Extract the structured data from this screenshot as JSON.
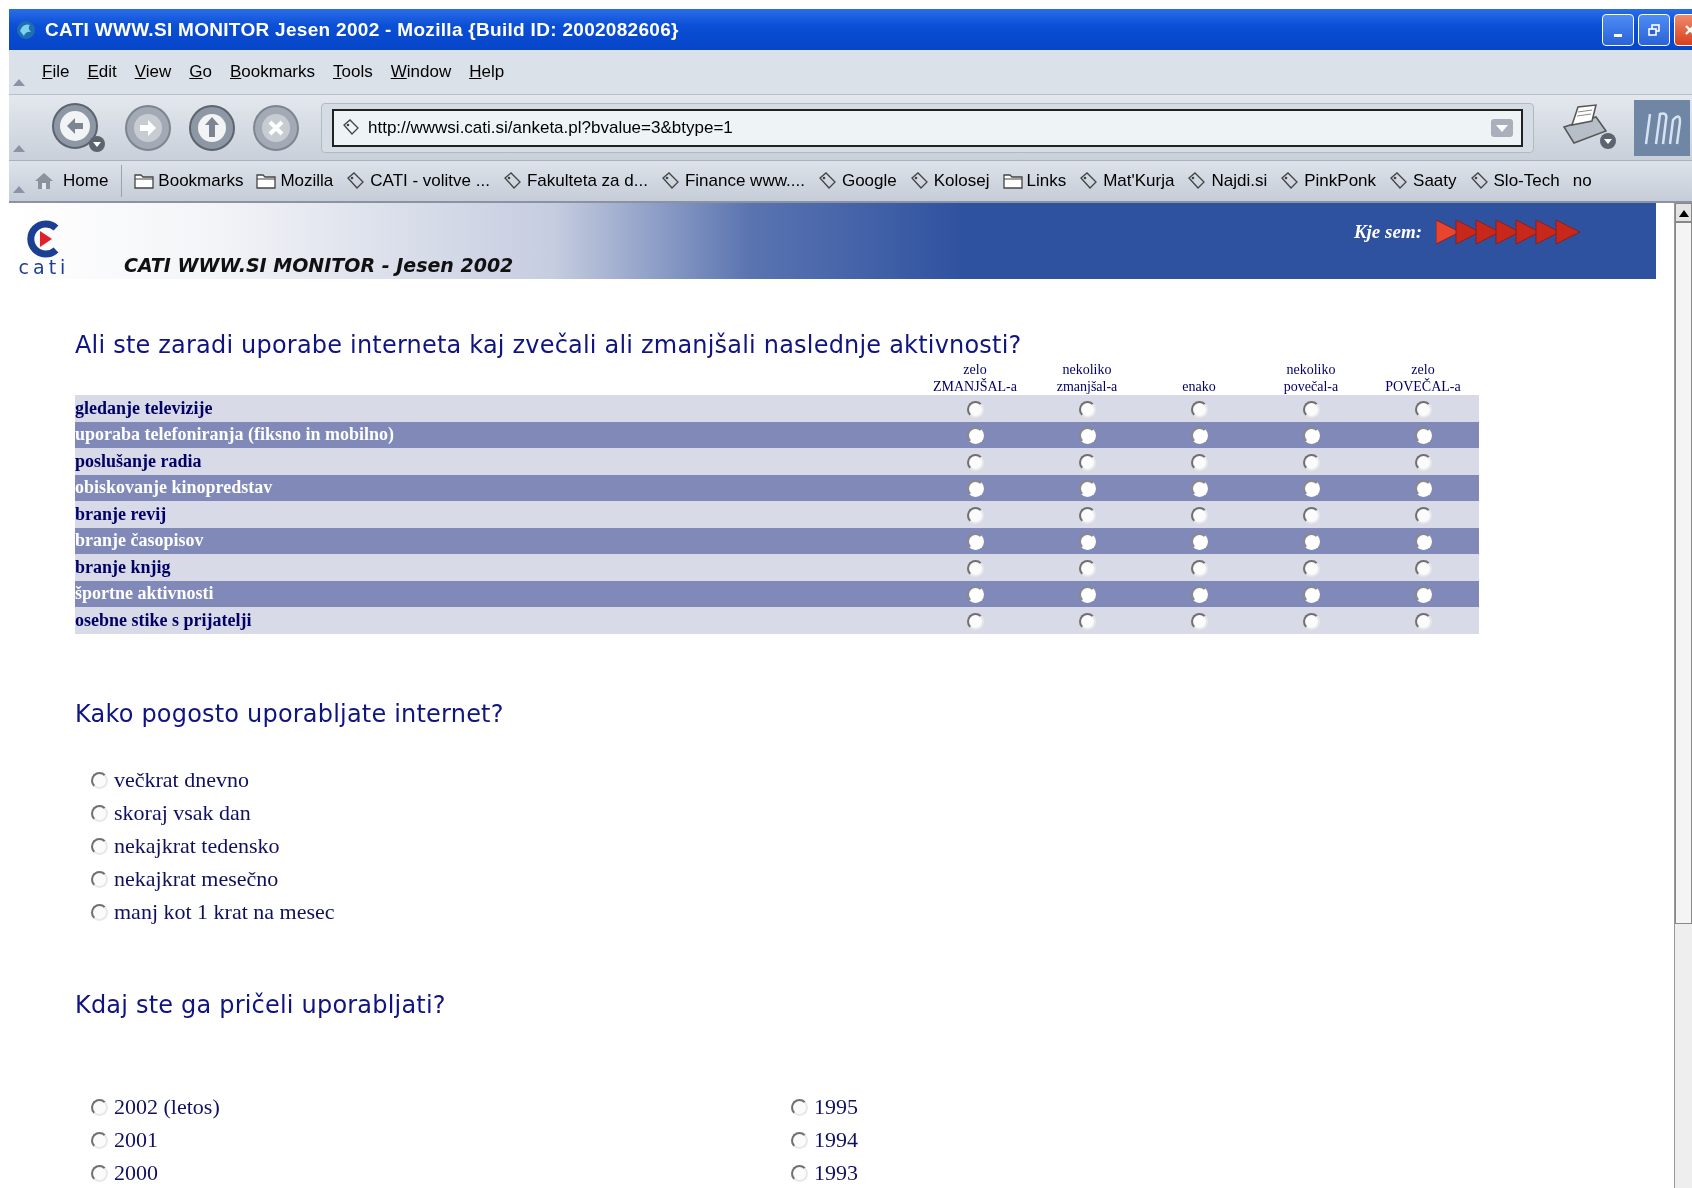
{
  "window": {
    "title": "CATI WWW.SI MONITOR Jesen 2002 - Mozilla {Build ID: 2002082606}"
  },
  "menu": [
    "File",
    "Edit",
    "View",
    "Go",
    "Bookmarks",
    "Tools",
    "Window",
    "Help"
  ],
  "address": {
    "value": "http://wwwsi.cati.si/anketa.pl?bvalue=3&btype=1"
  },
  "bookmarks": [
    {
      "label": "Home",
      "kind": "home"
    },
    {
      "label": "Bookmarks",
      "kind": "folder"
    },
    {
      "label": "Mozilla",
      "kind": "folder"
    },
    {
      "label": "CATI - volitve ...",
      "kind": "link"
    },
    {
      "label": "Fakulteta za d...",
      "kind": "link"
    },
    {
      "label": "Finance www....",
      "kind": "link"
    },
    {
      "label": "Google",
      "kind": "link"
    },
    {
      "label": "Kolosej",
      "kind": "link"
    },
    {
      "label": "Links",
      "kind": "folder"
    },
    {
      "label": "Mat'Kurja",
      "kind": "link"
    },
    {
      "label": "Najdi.si",
      "kind": "link"
    },
    {
      "label": "PinkPonk",
      "kind": "link"
    },
    {
      "label": "Saaty",
      "kind": "link"
    },
    {
      "label": "Slo-Tech",
      "kind": "link"
    },
    {
      "label": "no",
      "kind": "plain"
    }
  ],
  "banner": {
    "logo_text": "cati",
    "title": "CATI WWW.SI MONITOR - Jesen 2002",
    "location_label": "Kje sem:"
  },
  "questions": [
    {
      "kind": "matrix",
      "text": "Ali ste zaradi uporabe interneta kaj zvečali ali zmanjšali naslednje aktivnosti?",
      "columns": [
        "zelo\nZMANJŠAL-a",
        "nekoliko\nzmanjšal-a",
        "enako",
        "nekoliko\npovečal-a",
        "zelo\nPOVEČAL-a"
      ],
      "rows": [
        {
          "label": "gledanje televizije",
          "selected": [
            false,
            false,
            false,
            false,
            false
          ]
        },
        {
          "label": "uporaba telefoniranja (fiksno in mobilno)",
          "selected": [
            false,
            false,
            false,
            false,
            false
          ]
        },
        {
          "label": "poslušanje radia",
          "selected": [
            false,
            false,
            false,
            false,
            false
          ]
        },
        {
          "label": "obiskovanje kinopredstav",
          "selected": [
            false,
            false,
            false,
            false,
            false
          ]
        },
        {
          "label": "branje revij",
          "selected": [
            false,
            false,
            false,
            false,
            false
          ]
        },
        {
          "label": "branje časopisov",
          "selected": [
            false,
            false,
            false,
            false,
            false
          ]
        },
        {
          "label": "branje knjig",
          "selected": [
            false,
            false,
            false,
            false,
            false
          ]
        },
        {
          "label": "športne aktivnosti",
          "selected": [
            false,
            false,
            false,
            false,
            false
          ]
        },
        {
          "label": "osebne stike s prijatelji",
          "selected": [
            false,
            false,
            false,
            false,
            false
          ]
        }
      ]
    },
    {
      "kind": "single",
      "text": "Kako pogosto uporabljate internet?",
      "options": [
        {
          "label": "večkrat dnevno",
          "selected": false
        },
        {
          "label": "skoraj vsak dan",
          "selected": false
        },
        {
          "label": "nekajkrat tedensko",
          "selected": false
        },
        {
          "label": "nekajkrat mesečno",
          "selected": false
        },
        {
          "label": "manj kot 1 krat na mesec",
          "selected": false
        }
      ]
    },
    {
      "kind": "two_columns",
      "text": "Kdaj ste ga pričeli uporabljati?",
      "options": [
        {
          "label": "2002 (letos)",
          "selected": false
        },
        {
          "label": "2001",
          "selected": false
        },
        {
          "label": "2000",
          "selected": false
        },
        {
          "label": "1995",
          "selected": false
        },
        {
          "label": "1994",
          "selected": false
        },
        {
          "label": "1993",
          "selected": false
        }
      ]
    }
  ]
}
